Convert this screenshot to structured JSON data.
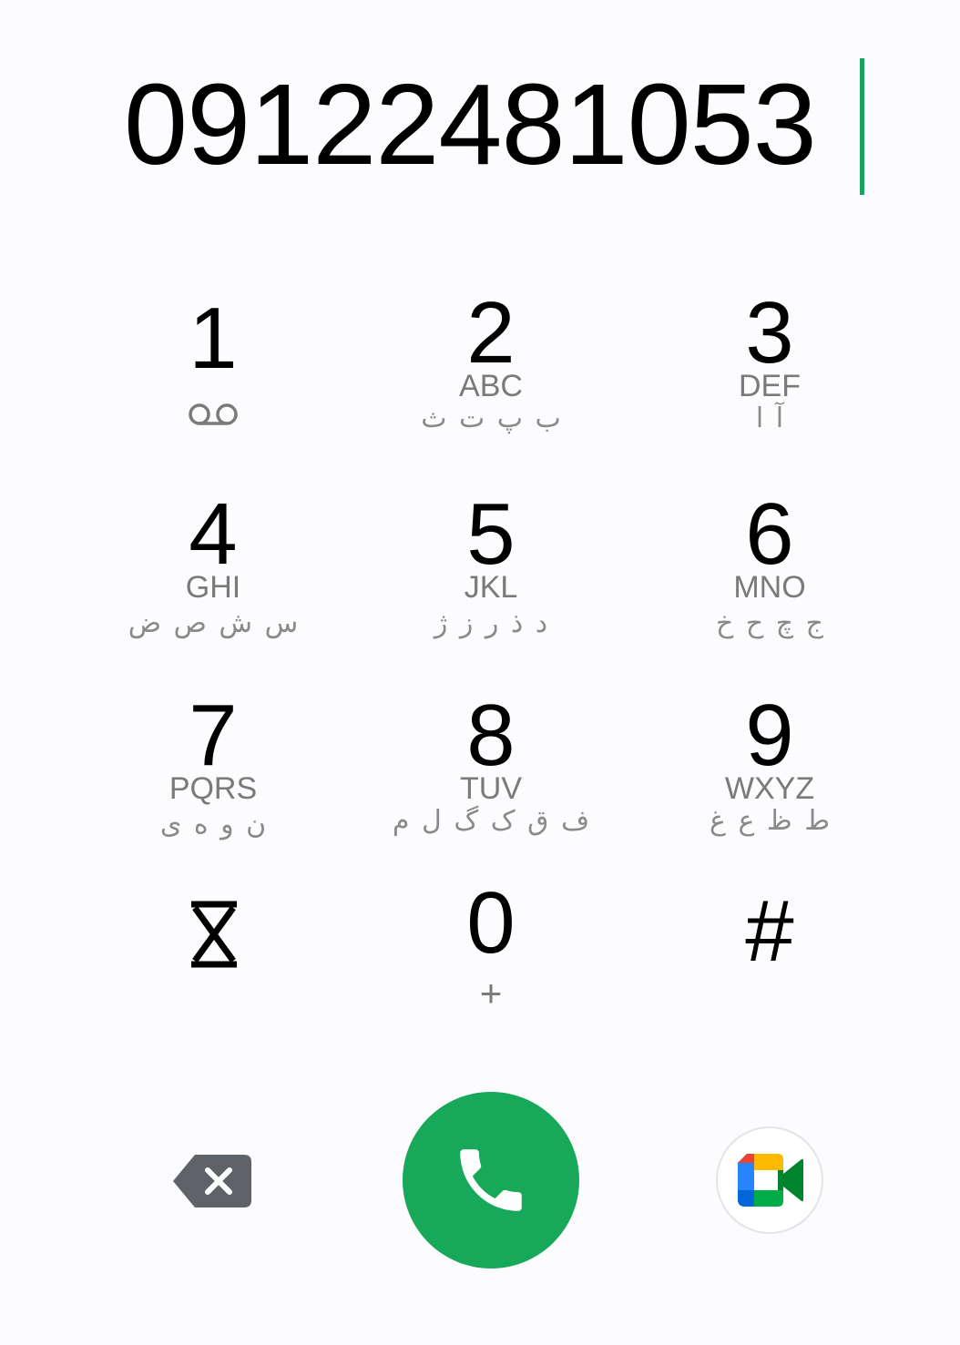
{
  "dialer": {
    "number": "09122481053"
  },
  "keypad": {
    "keys": [
      {
        "digit": "1",
        "latin": "",
        "persian": "",
        "icon": "voicemail-icon"
      },
      {
        "digit": "2",
        "latin": "ABC",
        "persian": "ب پ ت ث"
      },
      {
        "digit": "3",
        "latin": "DEF",
        "persian": "آ ا"
      },
      {
        "digit": "4",
        "latin": "GHI",
        "persian": "س ش ص ض"
      },
      {
        "digit": "5",
        "latin": "JKL",
        "persian": "د ذ ر ز ژ"
      },
      {
        "digit": "6",
        "latin": "MNO",
        "persian": "ج چ ح خ"
      },
      {
        "digit": "7",
        "latin": "PQRS",
        "persian": "ن و ه ی"
      },
      {
        "digit": "8",
        "latin": "TUV",
        "persian": "ف ق ک گ ل م"
      },
      {
        "digit": "9",
        "latin": "WXYZ",
        "persian": "ط ظ ع غ"
      },
      {
        "digit": "",
        "latin": "",
        "persian": "",
        "icon": "asterisk-icon"
      },
      {
        "digit": "0",
        "latin": "",
        "persian": "",
        "sub": "+"
      },
      {
        "digit": "#",
        "latin": "",
        "persian": ""
      }
    ]
  },
  "actions": {
    "backspace_icon": "backspace-icon",
    "call_icon": "phone-icon",
    "meet_icon": "google-meet-icon"
  },
  "colors": {
    "accent": "#1aa260",
    "call_button": "#18a85a",
    "secondary_text": "#7a7a7a"
  }
}
